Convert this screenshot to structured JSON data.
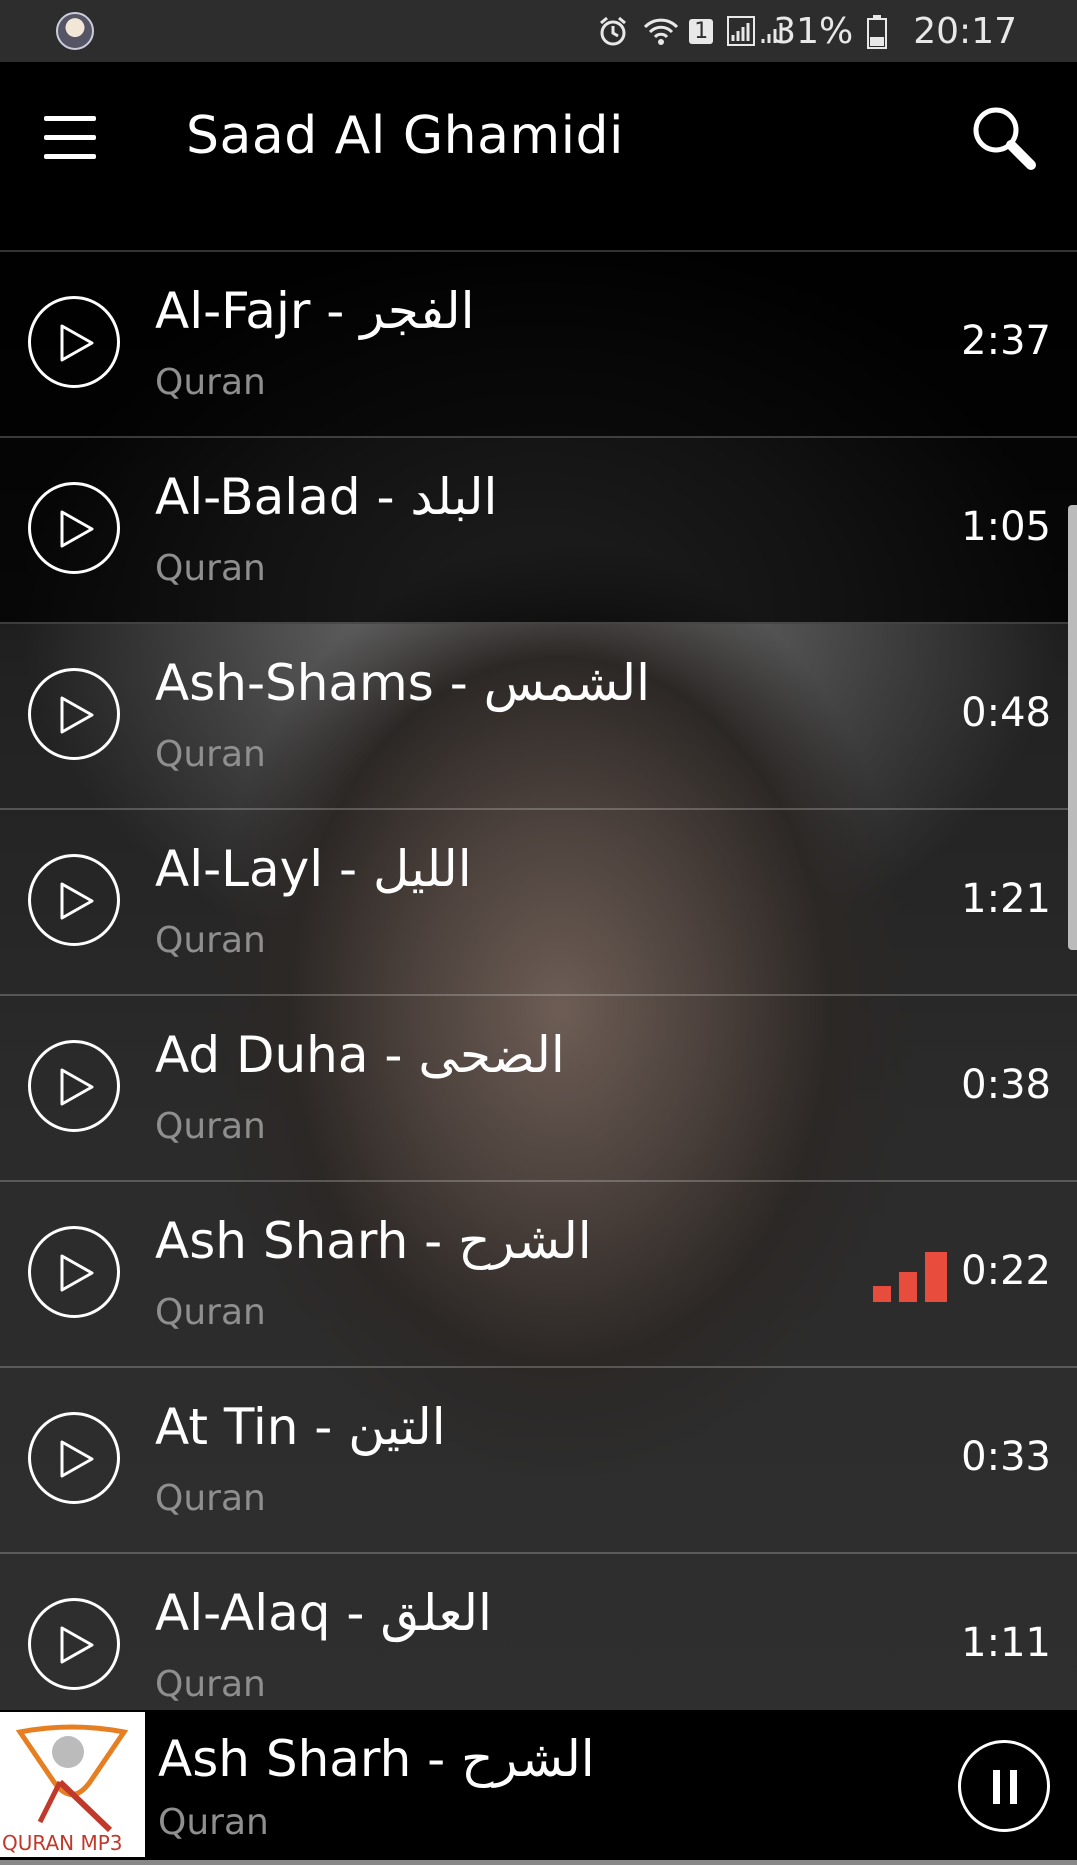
{
  "status_bar": {
    "battery": "31%",
    "time": "20:17",
    "sim_slot": "1"
  },
  "toolbar": {
    "title": "Saad Al Ghamidi"
  },
  "tracks": [
    {
      "title": "Al-Fajr - الفجر",
      "subtitle": "Quran",
      "duration": "2:37",
      "playing": false
    },
    {
      "title": "Al-Balad - البلد",
      "subtitle": "Quran",
      "duration": "1:05",
      "playing": false
    },
    {
      "title": "Ash-Shams - الشمس",
      "subtitle": "Quran",
      "duration": "0:48",
      "playing": false
    },
    {
      "title": "Al-Layl - الليل",
      "subtitle": "Quran",
      "duration": "1:21",
      "playing": false
    },
    {
      "title": "Ad  Duha - الضحى",
      "subtitle": "Quran",
      "duration": "0:38",
      "playing": false
    },
    {
      "title": "Ash Sharh - الشرح",
      "subtitle": "Quran",
      "duration": "0:22",
      "playing": true
    },
    {
      "title": "At Tin - التين",
      "subtitle": "Quran",
      "duration": "0:33",
      "playing": false
    },
    {
      "title": "Al-Alaq - العلق",
      "subtitle": "Quran",
      "duration": "1:11",
      "playing": false
    }
  ],
  "now_playing": {
    "title": "Ash Sharh - الشرح",
    "subtitle": "Quran",
    "artwork_label": "QURAN MP3"
  },
  "colors": {
    "accent": "#e74c3c",
    "subtitle": "#8f8f8f",
    "background": "#000000"
  },
  "icons": {
    "menu": "hamburger-icon",
    "search": "search-icon",
    "play": "play-icon",
    "pause": "pause-icon",
    "equalizer": "equalizer-icon"
  }
}
